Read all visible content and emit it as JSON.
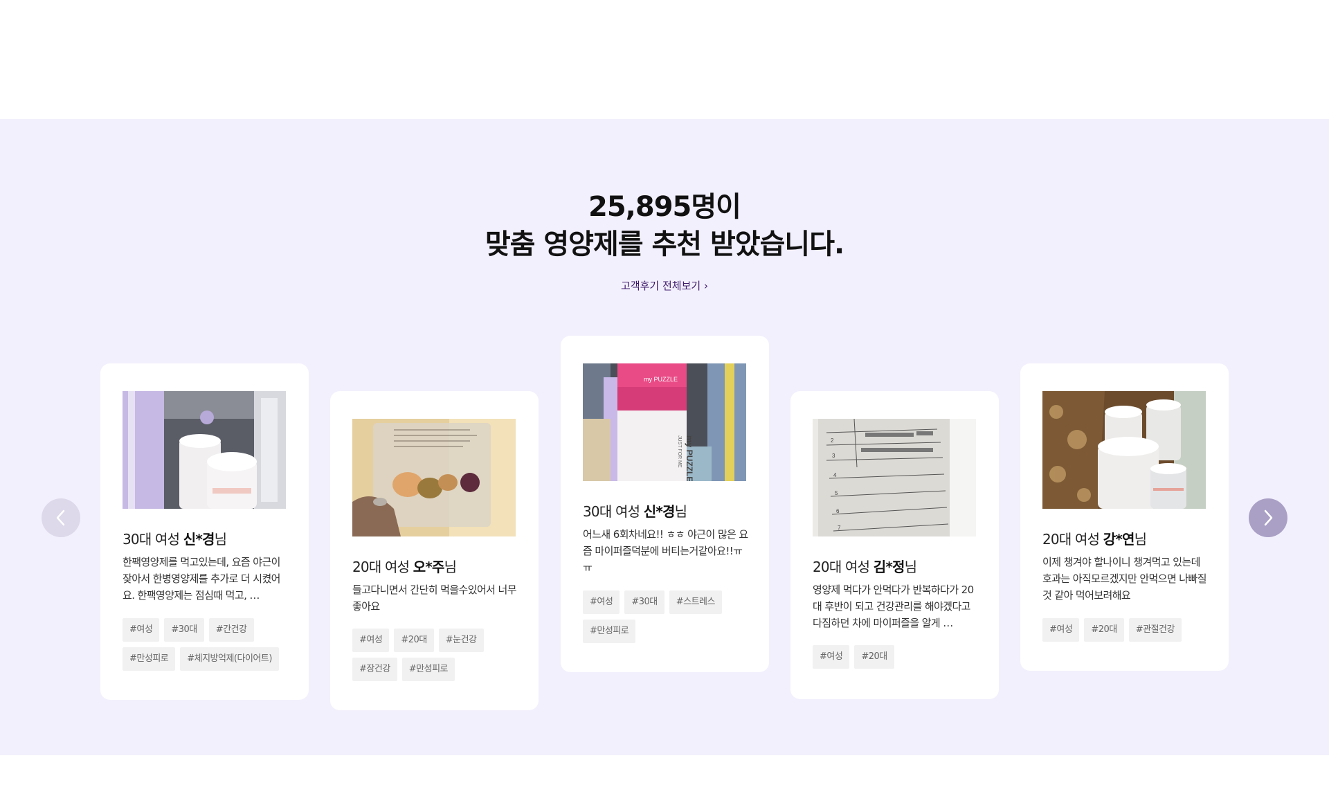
{
  "headline": {
    "line1": "25,895명이",
    "line2": "맞춤 영양제를 추천 받았습니다."
  },
  "view_all_label": "고객후기 전체보기 ›",
  "reviews": [
    {
      "age_gender": "30대 여성 ",
      "name": "신*경",
      "suffix": "님",
      "text": "한팩영양제를 먹고있는데, 요즘 야근이 잦아서 한병영양제를 추가로 더 시켰어요. 한팩영양제는 점심때 먹고, …",
      "tags": [
        "#여성",
        "#30대",
        "#간건강",
        "#만성피로",
        "#체지방억제(다이어트)"
      ]
    },
    {
      "age_gender": "20대 여성 ",
      "name": "오*주",
      "suffix": "님",
      "text": "들고다니면서 간단히 먹을수있어서 너무 좋아요",
      "tags": [
        "#여성",
        "#20대",
        "#눈건강",
        "#장건강",
        "#만성피로"
      ]
    },
    {
      "age_gender": "30대 여성 ",
      "name": "신*경",
      "suffix": "님",
      "text": "어느새 6회차네요!! ㅎㅎ 야근이 많은 요즘 마이퍼즐덕분에 버티는거같아요!!ㅠㅠ",
      "tags": [
        "#여성",
        "#30대",
        "#스트레스",
        "#만성피로"
      ]
    },
    {
      "age_gender": "20대 여성 ",
      "name": "김*정",
      "suffix": "님",
      "text": "영양제 먹다가 안먹다가 반복하다가 20대 후반이 되고 건강관리를 해야겠다고 다짐하던 차에 마이퍼즐을 알게 …",
      "tags": [
        "#여성",
        "#20대"
      ]
    },
    {
      "age_gender": "20대 여성 ",
      "name": "강*연",
      "suffix": "님",
      "text": "이제 챙겨야 할나이니 챙겨먹고 있는데 호과는 아직모르겠지만 안먹으면 나빠질것 같아 먹어보려해요",
      "tags": [
        "#여성",
        "#20대",
        "#관절건강"
      ]
    }
  ],
  "photo_texts": {
    "box_brand": "my PUZZLE",
    "box_tagline": "JUST FOR ME"
  },
  "icons": {
    "prev": "chevron-left-icon",
    "next": "chevron-right-icon"
  },
  "colors": {
    "section_bg": "#f3f0fd",
    "link": "#3e1a6b",
    "next_arrow": "#aaa0c6",
    "prev_arrow": "#ddd8ea"
  }
}
